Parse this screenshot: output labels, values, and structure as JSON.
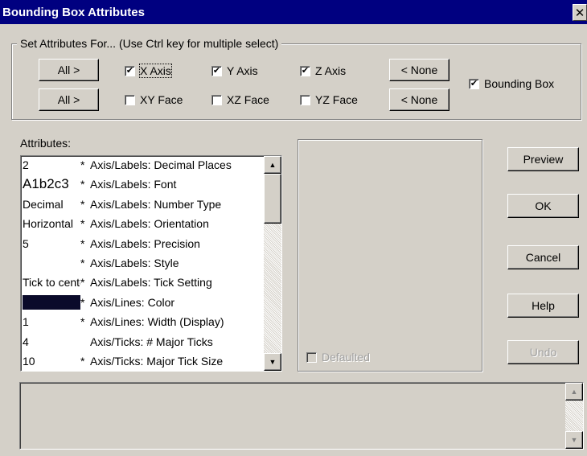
{
  "window": {
    "title": "Bounding Box Attributes",
    "close_glyph": "✕"
  },
  "set_for": {
    "legend": "Set Attributes For... (Use Ctrl key for multiple select)",
    "row1_all": "All >",
    "row2_all": "All >",
    "row1_none": "< None",
    "row2_none": "< None",
    "x_axis": {
      "label": "X Axis",
      "checked": true
    },
    "y_axis": {
      "label": "Y Axis",
      "checked": true
    },
    "z_axis": {
      "label": "Z Axis",
      "checked": true
    },
    "xy_face": {
      "label": "XY Face",
      "checked": false
    },
    "xz_face": {
      "label": "XZ Face",
      "checked": false
    },
    "yz_face": {
      "label": "YZ Face",
      "checked": false
    },
    "bounding_box": {
      "label": "Bounding Box",
      "checked": true
    }
  },
  "attributes": {
    "label": "Attributes:",
    "rows": [
      {
        "value": "2",
        "star": "*",
        "name": "Axis/Labels: Decimal Places"
      },
      {
        "value": "A1b2c3",
        "star": "*",
        "name": "Axis/Labels: Font",
        "big": true
      },
      {
        "value": "Decimal",
        "star": "*",
        "name": "Axis/Labels: Number Type"
      },
      {
        "value": "Horizontal",
        "star": "*",
        "name": "Axis/Labels: Orientation"
      },
      {
        "value": "5",
        "star": "*",
        "name": "Axis/Labels: Precision"
      },
      {
        "value": "",
        "star": "*",
        "name": "Axis/Labels: Style"
      },
      {
        "value": "Tick to center",
        "star": "*",
        "name": "Axis/Labels: Tick Setting"
      },
      {
        "value": "",
        "star": "*",
        "name": "Axis/Lines: Color",
        "swatch": "#0a0a2a"
      },
      {
        "value": "1",
        "star": "*",
        "name": "Axis/Lines: Width (Display)"
      },
      {
        "value": "4",
        "star": "",
        "name": "Axis/Ticks: # Major Ticks"
      },
      {
        "value": "10",
        "star": "*",
        "name": "Axis/Ticks: Major Tick Size"
      }
    ]
  },
  "defaulted": {
    "label": "Defaulted",
    "checked": false
  },
  "buttons": {
    "preview": "Preview",
    "ok": "OK",
    "cancel": "Cancel",
    "help": "Help",
    "undo": "Undo"
  }
}
